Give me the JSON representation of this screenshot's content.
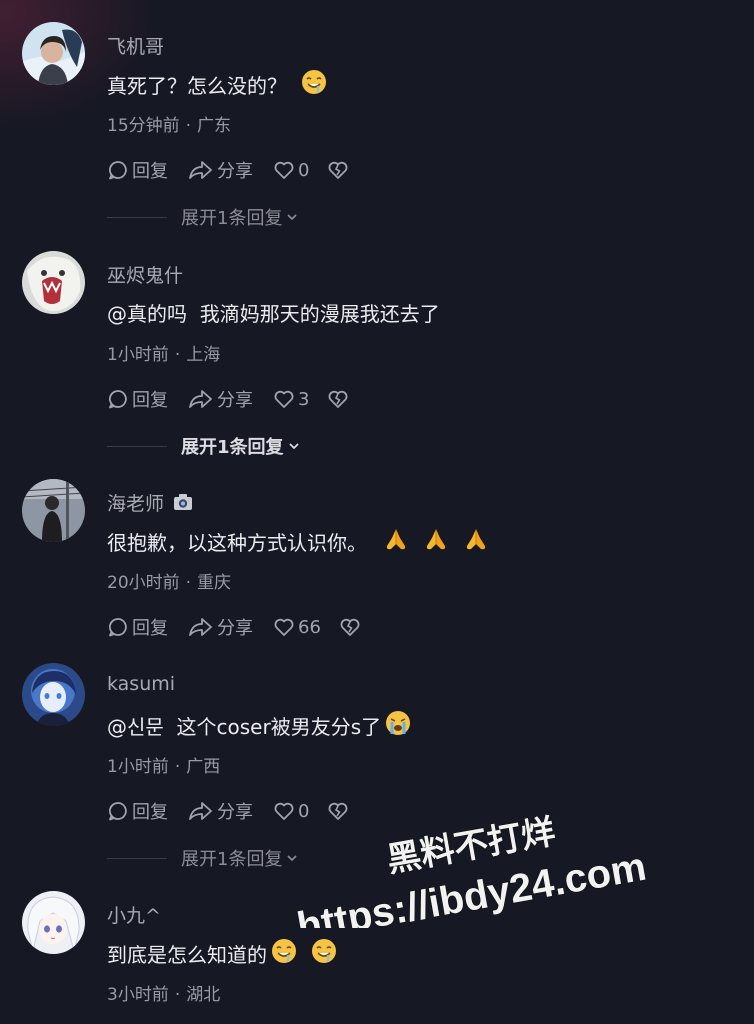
{
  "comments": [
    {
      "username": "飞机哥",
      "text": "真死了？怎么没的？",
      "emojis": [
        "drooling-face"
      ],
      "time": "15分钟前",
      "location": "广东",
      "reply_label": "回复",
      "share_label": "分享",
      "likes": "0",
      "expand_label": "展开1条回复"
    },
    {
      "username": "巫烬鬼什",
      "text": "@真的吗  我滴妈那天的漫展我还去了",
      "emojis": [],
      "time": "1小时前",
      "location": "上海",
      "reply_label": "回复",
      "share_label": "分享",
      "likes": "3",
      "expand_label": "展开1条回复"
    },
    {
      "username": "海老师",
      "text": "很抱歉，以这种方式认识你。",
      "emojis": [
        "folded-hands",
        "folded-hands",
        "folded-hands"
      ],
      "time": "20小时前",
      "location": "重庆",
      "reply_label": "回复",
      "share_label": "分享",
      "likes": "66"
    },
    {
      "username": "kasumi",
      "text": "@신문  这个coser被男友分s了",
      "emojis": [
        "crying-face"
      ],
      "time": "1小时前",
      "location": "广西",
      "reply_label": "回复",
      "share_label": "分享",
      "likes": "0",
      "expand_label": "展开1条回复"
    },
    {
      "username": "小九^",
      "text": "到底是怎么知道的",
      "emojis": [
        "drooling-face",
        "drooling-face"
      ],
      "time": "3小时前",
      "location": "湖北"
    }
  ],
  "watermark": {
    "line1": "黑料不打烊",
    "line2": "https://ibdy24.com"
  },
  "colors": {
    "background": "#161823",
    "text_primary": "#ececf0",
    "text_secondary": "#9a9aa4"
  }
}
